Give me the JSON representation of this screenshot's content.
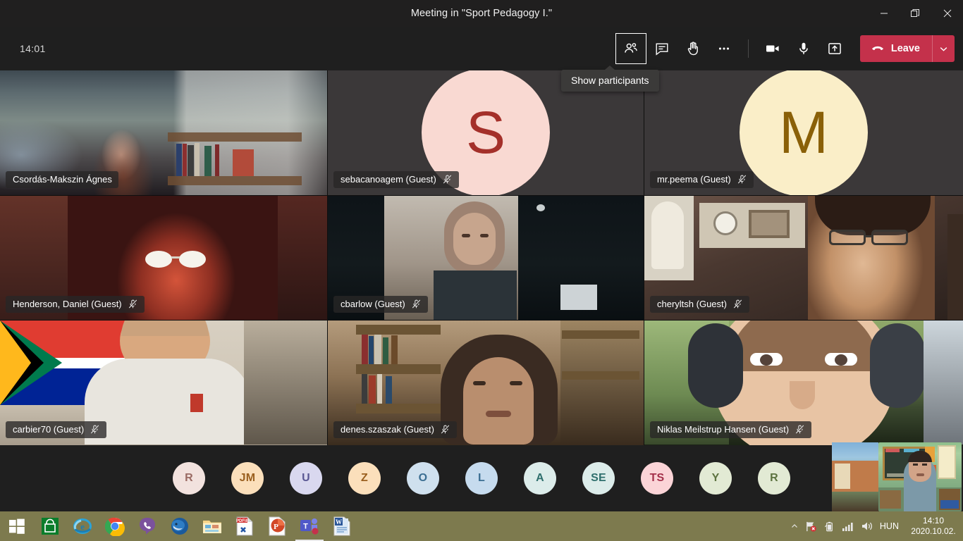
{
  "window": {
    "title": "Meeting in \"Sport Pedagogy I.\"",
    "controls": [
      {
        "name": "minimize",
        "glyph": "—"
      },
      {
        "name": "restore",
        "glyph": "❐"
      },
      {
        "name": "close",
        "glyph": "✕"
      }
    ]
  },
  "toolbar": {
    "timer": "14:01",
    "buttons": [
      {
        "name": "show-participants",
        "label": "Show participants",
        "focused": true
      },
      {
        "name": "show-conversation",
        "label": "Show conversation",
        "focused": false
      },
      {
        "name": "raise-hand",
        "label": "Raise your hand",
        "focused": false
      },
      {
        "name": "more-actions",
        "label": "More actions",
        "focused": false
      },
      {
        "name": "camera",
        "label": "Turn camera off",
        "focused": false
      },
      {
        "name": "microphone",
        "label": "Mute",
        "focused": false
      },
      {
        "name": "share",
        "label": "Share content",
        "focused": false
      }
    ],
    "leave_label": "Leave",
    "leave_color": "#c4314b"
  },
  "tooltip": {
    "text": "Show participants"
  },
  "grid": {
    "tiles": [
      {
        "name": "Csordás-Makszin Ágnes",
        "muted": false,
        "type": "video",
        "video": "woman-bookshelf"
      },
      {
        "name": "sebacanoagem (Guest)",
        "muted": true,
        "type": "avatar",
        "initial": "S",
        "bg": "#f9d9d2",
        "fg": "#a4302a"
      },
      {
        "name": "mr.peema (Guest)",
        "muted": true,
        "type": "avatar",
        "initial": "M",
        "bg": "#faeec8",
        "fg": "#8a6008"
      },
      {
        "name": "Henderson, Daniel (Guest)",
        "muted": true,
        "type": "video",
        "video": "man-dark-glasses"
      },
      {
        "name": "cbarlow (Guest)",
        "muted": true,
        "type": "video",
        "video": "man-dark-room"
      },
      {
        "name": "cheryltsh (Guest)",
        "muted": true,
        "type": "video",
        "video": "woman-glasses-sofa"
      },
      {
        "name": "carbier70 (Guest)",
        "muted": true,
        "type": "video",
        "video": "man-sa-flag"
      },
      {
        "name": "denes.szaszak (Guest)",
        "muted": true,
        "type": "video",
        "video": "man-bookshelf"
      },
      {
        "name": "Niklas Meilstrup Hansen (Guest)",
        "muted": true,
        "type": "video",
        "video": "man-headphones-car"
      }
    ]
  },
  "overflow_bar": {
    "avatars": [
      {
        "initial": "R",
        "bg": "#f2e2de",
        "fg": "#9a6a63"
      },
      {
        "initial": "JM",
        "bg": "#fbdfbb",
        "fg": "#9a5f1e"
      },
      {
        "initial": "U",
        "bg": "#d9d8ef",
        "fg": "#5a5893"
      },
      {
        "initial": "Z",
        "bg": "#fbdfbb",
        "fg": "#9a5f1e"
      },
      {
        "initial": "O",
        "bg": "#cfe0ee",
        "fg": "#3b6e92"
      },
      {
        "initial": "L",
        "bg": "#c6dbee",
        "fg": "#3b6e92"
      },
      {
        "initial": "A",
        "bg": "#dcecea",
        "fg": "#2f6f6d"
      },
      {
        "initial": "SE",
        "bg": "#dcecea",
        "fg": "#2f6f6d"
      },
      {
        "initial": "TS",
        "bg": "#fbd4d7",
        "fg": "#a4304a"
      },
      {
        "initial": "Y",
        "bg": "#e2ead4",
        "fg": "#5d7340"
      },
      {
        "initial": "R",
        "bg": "#e2ead4",
        "fg": "#5d7340"
      }
    ]
  },
  "selfview": {
    "label": "self-video-preview"
  },
  "taskbar": {
    "start_label": "Start",
    "items": [
      {
        "name": "microsoft-store",
        "label": "Microsoft Store",
        "active": false
      },
      {
        "name": "internet-explorer",
        "label": "Internet Explorer",
        "active": false
      },
      {
        "name": "google-chrome",
        "label": "Google Chrome",
        "active": false
      },
      {
        "name": "viber",
        "label": "Viber",
        "active": false
      },
      {
        "name": "thunderbird",
        "label": "Mozilla Thunderbird",
        "active": false
      },
      {
        "name": "file-explorer",
        "label": "File Explorer",
        "active": false
      },
      {
        "name": "pdfill",
        "label": "PDFill PDF Tools",
        "active": false
      },
      {
        "name": "powerpoint",
        "label": "Microsoft PowerPoint",
        "active": false
      },
      {
        "name": "microsoft-teams",
        "label": "Microsoft Teams",
        "active": true
      },
      {
        "name": "word",
        "label": "Microsoft Word",
        "active": false
      }
    ],
    "tray": {
      "language": "HUN",
      "time": "14:10",
      "date": "2020.10.02.",
      "icons": [
        "show-hidden-icons",
        "security-alert-icon",
        "battery-icon",
        "network-signal-icon",
        "volume-icon"
      ]
    }
  }
}
